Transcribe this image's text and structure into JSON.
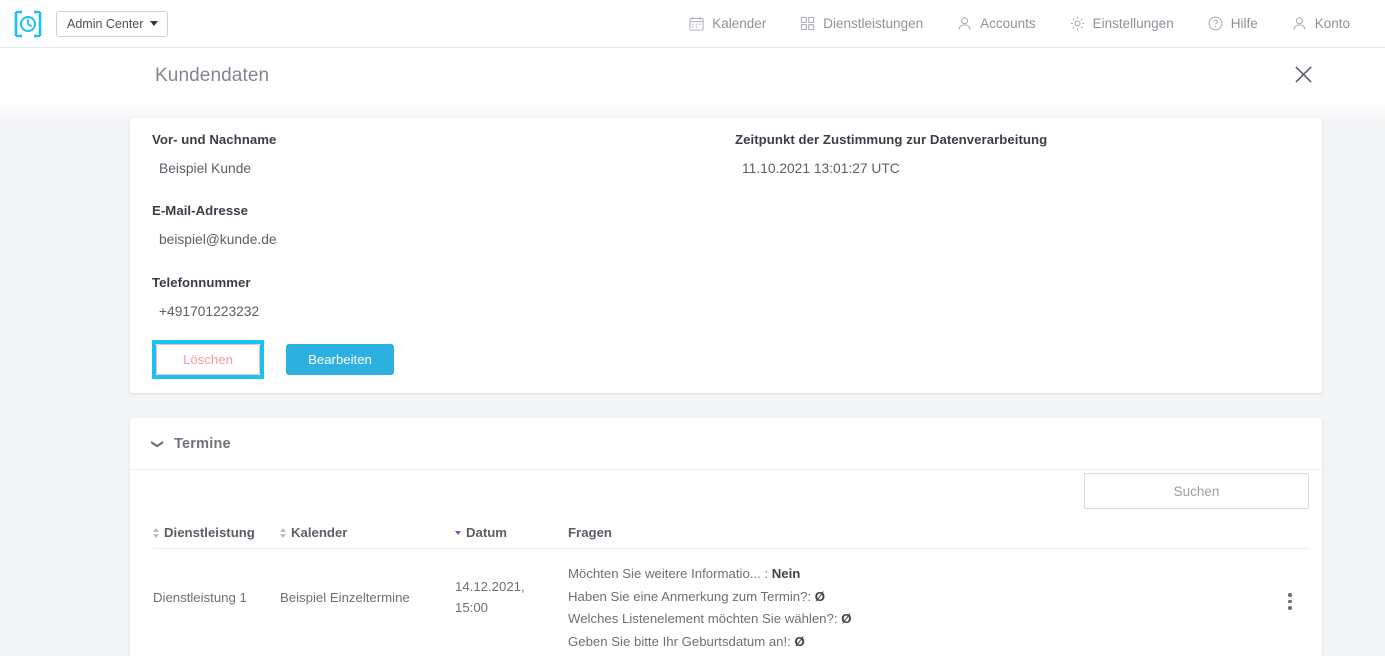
{
  "topbar": {
    "logo_icon": "clock-bracket-logo",
    "brand_select": {
      "label": "Admin Center",
      "icon": "chevron-down-icon"
    },
    "nav": [
      {
        "label": "Kalender",
        "icon": "calendar-icon"
      },
      {
        "label": "Dienstleistungen",
        "icon": "grid-icon"
      },
      {
        "label": "Accounts",
        "icon": "user-icon"
      },
      {
        "label": "Einstellungen",
        "icon": "gear-icon"
      },
      {
        "label": "Hilfe",
        "icon": "question-circle-icon"
      },
      {
        "label": "Konto",
        "icon": "user-icon"
      }
    ]
  },
  "page": {
    "title": "Kundendaten",
    "close_icon": "close-icon"
  },
  "customer": {
    "name_label": "Vor- und Nachname",
    "name_value": "Beispiel Kunde",
    "email_label": "E-Mail-Adresse",
    "email_value": "beispiel@kunde.de",
    "phone_label": "Telefonnummer",
    "phone_value": "+491701223232",
    "consent_label": "Zeitpunkt der Zustimmung zur Datenverarbeitung",
    "consent_value": "11.10.2021 13:01:27 UTC",
    "delete_button": "Löschen",
    "edit_button": "Bearbeiten"
  },
  "appointments": {
    "section_title": "Termine",
    "collapse_icon": "chevron-down-icon",
    "search": {
      "placeholder": "Suchen",
      "value": ""
    },
    "columns": [
      {
        "label": "Dienstleistung",
        "sortable": true,
        "sort": "none"
      },
      {
        "label": "Kalender",
        "sortable": true,
        "sort": "none"
      },
      {
        "label": "Datum",
        "sortable": true,
        "sort": "desc"
      },
      {
        "label": "Fragen",
        "sortable": false,
        "sort": "none"
      }
    ],
    "rows": [
      {
        "service": "Dienstleistung 1",
        "calendar": "Beispiel Einzeltermine",
        "date": "14.12.2021, 15:00",
        "questions": [
          {
            "q": "Möchten Sie weitere Informatio... :",
            "a": "Nein"
          },
          {
            "q": "Haben Sie eine Anmerkung zum Termin?:",
            "a": "Ø"
          },
          {
            "q": "Welches Listenelement möchten Sie wählen?:",
            "a": "Ø"
          },
          {
            "q": "Geben Sie bitte Ihr Geburtsdatum an!:",
            "a": "Ø"
          }
        ],
        "menu_icon": "kebab-menu-icon"
      }
    ]
  },
  "colors": {
    "accent_cyan": "#19c2f3",
    "primary_button": "#2bb0e0",
    "delete_border": "#f5b9bd",
    "delete_text": "#f29ba2",
    "sort_active": "#5a5fd4",
    "page_bg": "#f4f5f7"
  }
}
